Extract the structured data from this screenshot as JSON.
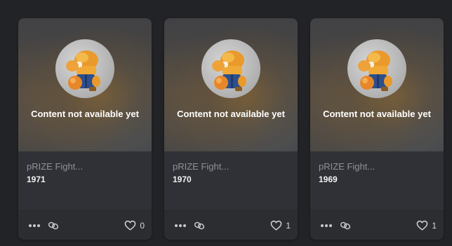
{
  "colors": {
    "background": "#222326",
    "card": "#2e3035",
    "title_text": "#8f9196",
    "edition_text": "#f2f2f2",
    "icon": "#c9cace"
  },
  "cards": [
    {
      "overlay_text": "Content not available yet",
      "title": "pRIZE Fight...",
      "edition": "1971",
      "likes": "0",
      "icons": {
        "more": "more-dots-icon",
        "link": "link-icon",
        "like": "heart-icon"
      }
    },
    {
      "overlay_text": "Content not available yet",
      "title": "pRIZE Fight...",
      "edition": "1970",
      "likes": "1",
      "icons": {
        "more": "more-dots-icon",
        "link": "link-icon",
        "like": "heart-icon"
      }
    },
    {
      "overlay_text": "Content not available yet",
      "title": "pRIZE Fight...",
      "edition": "1969",
      "likes": "1",
      "icons": {
        "more": "more-dots-icon",
        "link": "link-icon",
        "like": "heart-icon"
      }
    }
  ]
}
